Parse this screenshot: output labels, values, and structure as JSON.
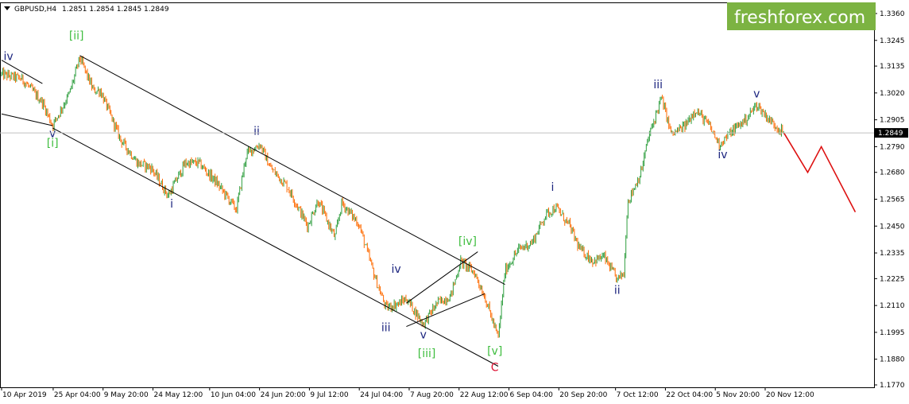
{
  "header": {
    "symbol": "GBPUSD,H4",
    "ohlc": "1.2851 1.2854 1.2845 1.2849"
  },
  "logo": {
    "text": "freshforex.com",
    "bg_color": "#7cb342"
  },
  "current_price": "1.2849",
  "colors": {
    "bull": "#2e9e3e",
    "bear": "#ff6a00",
    "forecast": "#dd1111",
    "primary_wave": "#3ebd3e",
    "minor_wave": "#1a237e",
    "major_label": "#dd1133",
    "channel": "#000000"
  },
  "chart_data": {
    "type": "candlestick",
    "title": "GBPUSD,H4",
    "y_ticks": [
      "1.3360",
      "1.3245",
      "1.3135",
      "1.3020",
      "1.2905",
      "1.2790",
      "1.2680",
      "1.2565",
      "1.2450",
      "1.2335",
      "1.2225",
      "1.2110",
      "1.1995",
      "1.1880",
      "1.1770"
    ],
    "ylim": [
      1.177,
      1.336
    ],
    "x_ticks": [
      "10 Apr 2019",
      "25 Apr 04:00",
      "9 May 20:00",
      "24 May 12:00",
      "10 Jun 04:00",
      "24 Jun 20:00",
      "9 Jul 12:00",
      "24 Jul 04:00",
      "7 Aug 20:00",
      "22 Aug 12:00",
      "6 Sep 04:00",
      "20 Sep 20:00",
      "7 Oct 12:00",
      "22 Oct 04:00",
      "5 Nov 20:00",
      "20 Nov 12:00"
    ],
    "price_path": [
      {
        "t": "10 Apr 2019",
        "price": 1.31
      },
      {
        "t": "16 Apr",
        "price": 1.308
      },
      {
        "t": "22 Apr",
        "price": 1.298
      },
      {
        "t": "25 Apr",
        "price": 1.288
      },
      {
        "t": "30 Apr",
        "price": 1.302
      },
      {
        "t": "3 May",
        "price": 1.317
      },
      {
        "t": "7 May",
        "price": 1.303
      },
      {
        "t": "9 May",
        "price": 1.303
      },
      {
        "t": "15 May",
        "price": 1.282
      },
      {
        "t": "20 May",
        "price": 1.272
      },
      {
        "t": "24 May",
        "price": 1.27
      },
      {
        "t": "29 May",
        "price": 1.258
      },
      {
        "t": "3 Jun",
        "price": 1.272
      },
      {
        "t": "7 Jun",
        "price": 1.272
      },
      {
        "t": "12 Jun",
        "price": 1.264
      },
      {
        "t": "18 Jun",
        "price": 1.252
      },
      {
        "t": "21 Jun",
        "price": 1.276
      },
      {
        "t": "25 Jun",
        "price": 1.28
      },
      {
        "t": "28 Jun",
        "price": 1.27
      },
      {
        "t": "3 Jul",
        "price": 1.262
      },
      {
        "t": "9 Jul",
        "price": 1.245
      },
      {
        "t": "12 Jul",
        "price": 1.256
      },
      {
        "t": "17 Jul",
        "price": 1.24
      },
      {
        "t": "19 Jul",
        "price": 1.255
      },
      {
        "t": "24 Jul",
        "price": 1.246
      },
      {
        "t": "29 Jul",
        "price": 1.222
      },
      {
        "t": "1 Aug",
        "price": 1.21
      },
      {
        "t": "5 Aug",
        "price": 1.212
      },
      {
        "t": "7 Aug",
        "price": 1.214
      },
      {
        "t": "12 Aug",
        "price": 1.203
      },
      {
        "t": "16 Aug",
        "price": 1.212
      },
      {
        "t": "20 Aug",
        "price": 1.215
      },
      {
        "t": "23 Aug",
        "price": 1.23
      },
      {
        "t": "27 Aug",
        "price": 1.225
      },
      {
        "t": "30 Aug",
        "price": 1.215
      },
      {
        "t": "3 Sep",
        "price": 1.197
      },
      {
        "t": "5 Sep",
        "price": 1.226
      },
      {
        "t": "9 Sep",
        "price": 1.235
      },
      {
        "t": "13 Sep",
        "price": 1.238
      },
      {
        "t": "17 Sep",
        "price": 1.25
      },
      {
        "t": "20 Sep",
        "price": 1.253
      },
      {
        "t": "24 Sep",
        "price": 1.245
      },
      {
        "t": "27 Sep",
        "price": 1.235
      },
      {
        "t": "1 Oct",
        "price": 1.23
      },
      {
        "t": "4 Oct",
        "price": 1.232
      },
      {
        "t": "8 Oct",
        "price": 1.222
      },
      {
        "t": "10 Oct",
        "price": 1.225
      },
      {
        "t": "11 Oct",
        "price": 1.255
      },
      {
        "t": "15 Oct",
        "price": 1.268
      },
      {
        "t": "17 Oct",
        "price": 1.282
      },
      {
        "t": "21 Oct",
        "price": 1.3
      },
      {
        "t": "24 Oct",
        "price": 1.284
      },
      {
        "t": "28 Oct",
        "price": 1.288
      },
      {
        "t": "31 Oct",
        "price": 1.295
      },
      {
        "t": "4 Nov",
        "price": 1.288
      },
      {
        "t": "7 Nov",
        "price": 1.28
      },
      {
        "t": "11 Nov",
        "price": 1.286
      },
      {
        "t": "15 Nov",
        "price": 1.291
      },
      {
        "t": "18 Nov",
        "price": 1.297
      },
      {
        "t": "22 Nov",
        "price": 1.29
      },
      {
        "t": "26 Nov",
        "price": 1.2849
      }
    ],
    "forecast": [
      {
        "t": "26 Nov",
        "price": 1.2849
      },
      {
        "t": "3 Dec",
        "price": 1.268
      },
      {
        "t": "7 Dec",
        "price": 1.279
      },
      {
        "t": "17 Dec",
        "price": 1.251
      }
    ],
    "channel_lines": [
      {
        "name": "upper",
        "from": {
          "t": "3 May",
          "price": 1.318
        },
        "to": {
          "t": "5 Sep",
          "price": 1.22
        }
      },
      {
        "name": "lower",
        "from": {
          "t": "25 Apr",
          "price": 1.287
        },
        "to": {
          "t": "3 Sep",
          "price": 1.185
        }
      },
      {
        "name": "left-upper",
        "from": {
          "t": "10 Apr 2019",
          "price": 1.316
        },
        "to": {
          "t": "22 Apr",
          "price": 1.306
        }
      },
      {
        "name": "left-lower",
        "from": {
          "t": "10 Apr 2019",
          "price": 1.293
        },
        "to": {
          "t": "25 Apr",
          "price": 1.288
        }
      },
      {
        "name": "triangle-upper",
        "from": {
          "t": "7 Aug",
          "price": 1.212
        },
        "to": {
          "t": "28 Aug",
          "price": 1.234
        }
      },
      {
        "name": "triangle-lower",
        "from": {
          "t": "7 Aug",
          "price": 1.202
        },
        "to": {
          "t": "30 Aug",
          "price": 1.216
        }
      }
    ],
    "wave_labels": [
      {
        "text": "iv",
        "t": "12 Apr",
        "price": 1.316,
        "style": "minor"
      },
      {
        "text": "[ii]",
        "t": "2 May",
        "price": 1.325,
        "style": "primary"
      },
      {
        "text": "v",
        "t": "25 Apr",
        "price": 1.283,
        "style": "minor"
      },
      {
        "text": "[i]",
        "t": "25 Apr",
        "price": 1.279,
        "style": "primary"
      },
      {
        "text": "i",
        "t": "30 May",
        "price": 1.253,
        "style": "minor"
      },
      {
        "text": "ii",
        "t": "24 Jun",
        "price": 1.284,
        "style": "minor"
      },
      {
        "text": "iii",
        "t": "1 Aug",
        "price": 1.2,
        "style": "minor"
      },
      {
        "text": "iv",
        "t": "4 Aug",
        "price": 1.225,
        "style": "minor"
      },
      {
        "text": "v",
        "t": "12 Aug",
        "price": 1.197,
        "style": "minor"
      },
      {
        "text": "[iii]",
        "t": "13 Aug",
        "price": 1.189,
        "style": "primary"
      },
      {
        "text": "[iv]",
        "t": "25 Aug",
        "price": 1.237,
        "style": "primary"
      },
      {
        "text": "[v]",
        "t": "2 Sep",
        "price": 1.19,
        "style": "primary"
      },
      {
        "text": "C",
        "t": "2 Sep",
        "price": 1.183,
        "style": "major"
      },
      {
        "text": "i",
        "t": "19 Sep",
        "price": 1.26,
        "style": "minor"
      },
      {
        "text": "ii",
        "t": "8 Oct",
        "price": 1.216,
        "style": "minor"
      },
      {
        "text": "iii",
        "t": "20 Oct",
        "price": 1.304,
        "style": "minor"
      },
      {
        "text": "iv",
        "t": "8 Nov",
        "price": 1.274,
        "style": "minor"
      },
      {
        "text": "v",
        "t": "18 Nov",
        "price": 1.3,
        "style": "minor"
      }
    ],
    "xlabel": "",
    "ylabel": "",
    "grid": false
  }
}
